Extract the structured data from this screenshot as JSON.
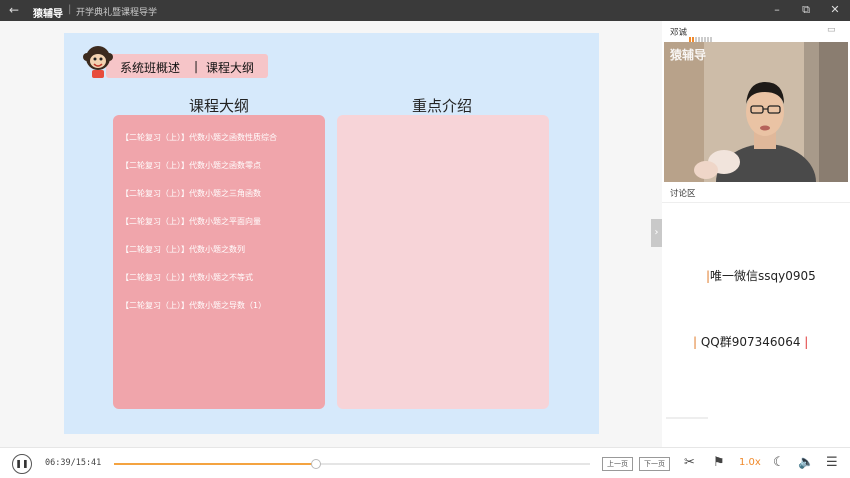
{
  "titlebar": {
    "app_name": "猿辅导",
    "course_title": "开学典礼暨课程导学",
    "back_icon": "←",
    "minimize_icon": "–",
    "restore_icon": "⧉",
    "close_icon": "✕"
  },
  "slide": {
    "header_left": "系统班概述",
    "header_divider": "|",
    "header_right": "课程大纲",
    "left_title": "课程大纲",
    "right_title": "重点介绍",
    "items": [
      "【二轮复习（上）】代数小题之函数性质综合",
      "【二轮复习（上）】代数小题之函数零点",
      "【二轮复习（上）】代数小题之三角函数",
      "【二轮复习（上）】代数小题之平面向量",
      "【二轮复习（上）】代数小题之数列",
      "【二轮复习（上）】代数小题之不等式",
      "【二轮复习（上）】代数小题之导数（1）"
    ],
    "colors": {
      "background": "#d6e9fb",
      "left_box": "#f0a5ab",
      "right_box": "#f7d4d8",
      "pill": "#f6c5c8"
    }
  },
  "sidebar": {
    "teacher_name": "邓诚",
    "audio_level": 0.3,
    "video_watermark": "猿辅导",
    "discussion_label": "讨论区",
    "expand_icon": "›",
    "ad_line1": "唯一微信ssqy0905",
    "ad_line2": "QQ群907346064"
  },
  "player": {
    "current_time": "06:39",
    "total_time": "15:41",
    "time_display": "06:39/15:41",
    "progress": 0.424,
    "prev_page_label": "上一页",
    "next_page_label": "下一页",
    "speed": "1.0x",
    "play_icon": "❚❚",
    "scissors_icon": "✂",
    "flag_icon": "⚑",
    "night_icon": "☾",
    "volume_icon": "🔈",
    "menu_icon": "☰",
    "accent": "#f4a340"
  }
}
